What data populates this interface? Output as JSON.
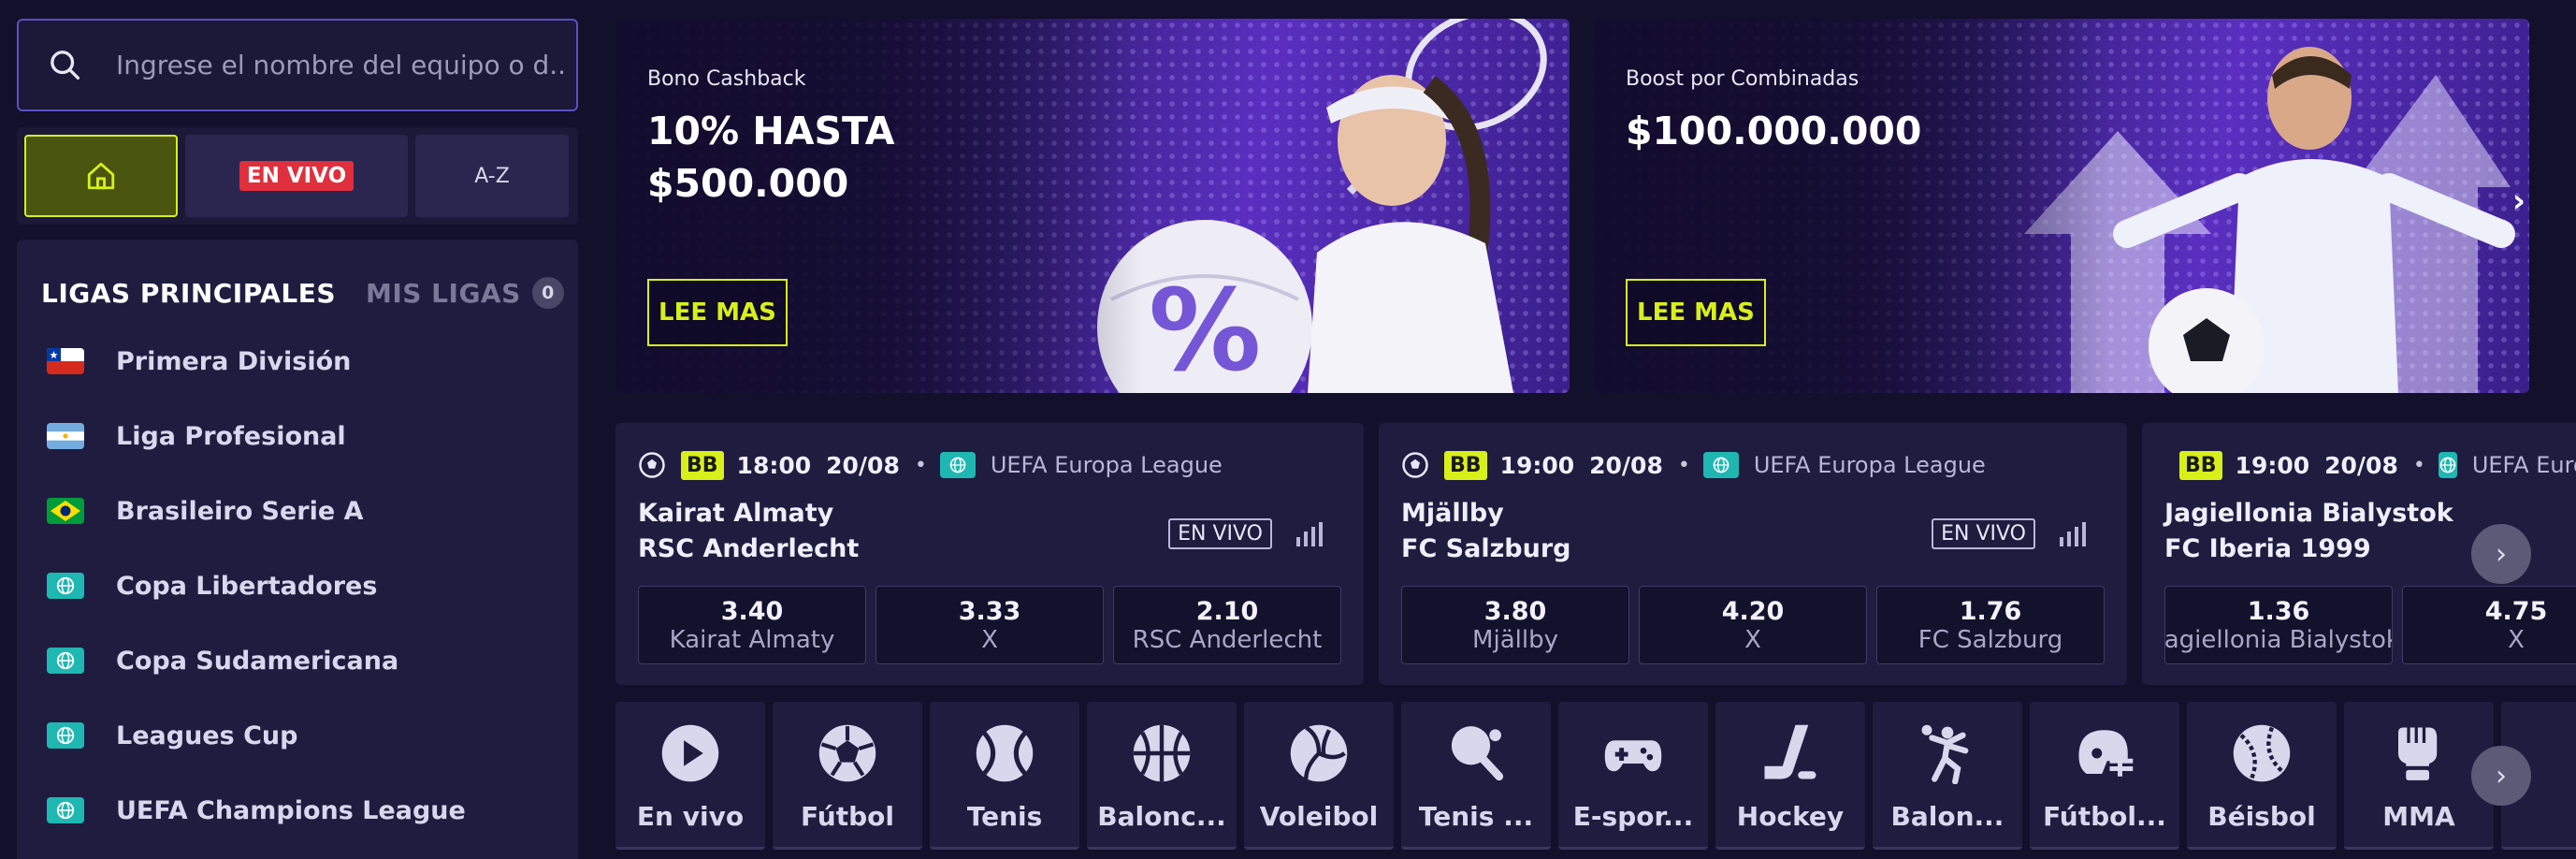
{
  "search": {
    "placeholder": "Ingrese el nombre del equipo o d..."
  },
  "quicknav": {
    "live_label": "EN VIVO",
    "az_label": "A-Z"
  },
  "leagues": {
    "tab_main": "LIGAS PRINCIPALES",
    "tab_mine": "MIS LIGAS",
    "mine_count": "0",
    "items": [
      {
        "label": "Primera División",
        "flag": "chile"
      },
      {
        "label": "Liga Profesional",
        "flag": "argentina"
      },
      {
        "label": "Brasileiro Serie A",
        "flag": "brazil"
      },
      {
        "label": "Copa Libertadores",
        "flag": "globe-icon"
      },
      {
        "label": "Copa Sudamericana",
        "flag": "globe-icon"
      },
      {
        "label": "Leagues Cup",
        "flag": "globe-icon"
      },
      {
        "label": "UEFA Champions League",
        "flag": "globe-icon"
      }
    ]
  },
  "banners": [
    {
      "kicker": "Bono Cashback",
      "headline": "10% HASTA $500.000",
      "cta": "LEE MAS"
    },
    {
      "kicker": "Boost por Combinadas",
      "headline": "$100.000.000",
      "cta": "LEE MAS"
    }
  ],
  "matches": [
    {
      "badge": "BB",
      "time": "18:00",
      "date": "20/08",
      "competition": "UEFA Europa League",
      "home": "Kairat Almaty",
      "away": "RSC Anderlecht",
      "live_label": "EN VIVO",
      "odds": [
        {
          "price": "3.40",
          "label": "Kairat Almaty"
        },
        {
          "price": "3.33",
          "label": "X"
        },
        {
          "price": "2.10",
          "label": "RSC Anderlecht"
        }
      ]
    },
    {
      "badge": "BB",
      "time": "19:00",
      "date": "20/08",
      "competition": "UEFA Europa League",
      "home": "Mjällby",
      "away": "FC Salzburg",
      "live_label": "EN VIVO",
      "odds": [
        {
          "price": "3.80",
          "label": "Mjällby"
        },
        {
          "price": "4.20",
          "label": "X"
        },
        {
          "price": "1.76",
          "label": "FC Salzburg"
        }
      ]
    },
    {
      "badge": "BB",
      "time": "19:00",
      "date": "20/08",
      "competition": "UEFA Europa League",
      "home": "Jagiellonia Bialystok",
      "away": "FC Iberia 1999",
      "odds": [
        {
          "price": "1.36",
          "label": "Jagiellonia Bialystok"
        },
        {
          "price": "4.75",
          "label": "X"
        }
      ]
    }
  ],
  "sports": [
    {
      "label": "En vivo",
      "icon": "play-icon"
    },
    {
      "label": "Fútbol",
      "icon": "soccer-ball-icon"
    },
    {
      "label": "Tenis",
      "icon": "tennis-ball-icon"
    },
    {
      "label": "Balonc...",
      "icon": "basketball-icon"
    },
    {
      "label": "Voleibol",
      "icon": "volleyball-icon"
    },
    {
      "label": "Tenis ...",
      "icon": "table-tennis-icon"
    },
    {
      "label": "E-spor...",
      "icon": "gamepad-icon"
    },
    {
      "label": "Hockey",
      "icon": "hockey-stick-icon"
    },
    {
      "label": "Balon...",
      "icon": "handball-icon"
    },
    {
      "label": "Fútbol...",
      "icon": "football-helmet-icon"
    },
    {
      "label": "Béisbol",
      "icon": "baseball-icon"
    },
    {
      "label": "MMA",
      "icon": "boxing-glove-icon"
    }
  ],
  "colors": {
    "accent": "#d8f01a",
    "live": "#e02f3d",
    "panel": "#1f1c40",
    "background": "#12102a",
    "globe": "#1fb7b2"
  }
}
